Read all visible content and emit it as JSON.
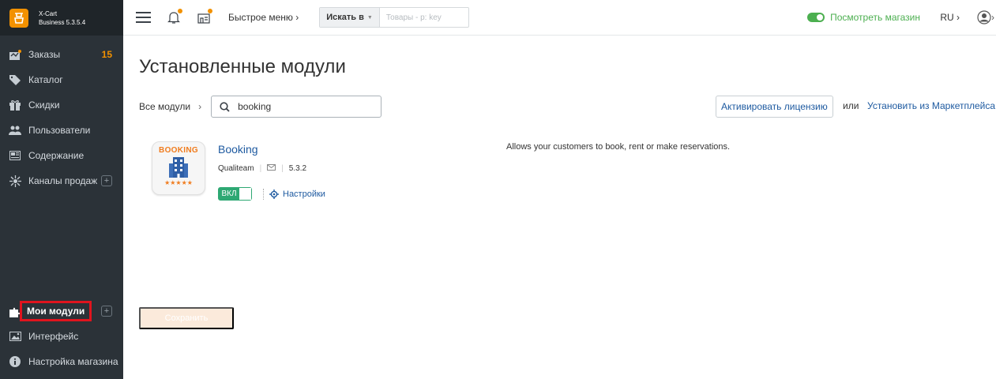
{
  "brand": {
    "line1": "X-Cart",
    "line2": "Business 5.3.5.4"
  },
  "sidebar": {
    "items": [
      {
        "label": "Заказы",
        "badge": "15",
        "icon": "orders-icon"
      },
      {
        "label": "Каталог",
        "icon": "tag-icon"
      },
      {
        "label": "Скидки",
        "icon": "gift-icon"
      },
      {
        "label": "Пользователи",
        "icon": "users-icon"
      },
      {
        "label": "Содержание",
        "icon": "content-icon"
      },
      {
        "label": "Каналы продаж",
        "icon": "channels-icon"
      }
    ],
    "bottom_items": [
      {
        "label": "Мои модули",
        "icon": "puzzle-icon"
      },
      {
        "label": "Интерфейс",
        "icon": "image-icon"
      },
      {
        "label": "Настройка магазина",
        "icon": "info-icon"
      }
    ]
  },
  "topbar": {
    "quick_menu": "Быстрое меню",
    "search_in": "Искать в",
    "search_placeholder": "Товары - p: key",
    "view_store": "Посмотреть магазин",
    "language": "RU"
  },
  "main": {
    "title": "Установленные модули",
    "breadcrumb": "Все модули",
    "filter_value": "booking",
    "activate_license": "Активировать лицензию",
    "or": "или",
    "install_marketplace": "Установить из Маркетплейса",
    "save": "Сохранить"
  },
  "module": {
    "icon_word": "BOOKING",
    "icon_stars": "★★★★★",
    "name": "Booking",
    "author": "Qualiteam",
    "version": "5.3.2",
    "switch_label": "ВКЛ",
    "settings": "Настройки",
    "description": "Allows your customers to book, rent or make reservations."
  },
  "colors": {
    "sidebar_bg": "#2b3238",
    "accent": "#f29100",
    "link": "#1e5aa0",
    "green": "#4caf50",
    "highlight": "#e0141e"
  }
}
